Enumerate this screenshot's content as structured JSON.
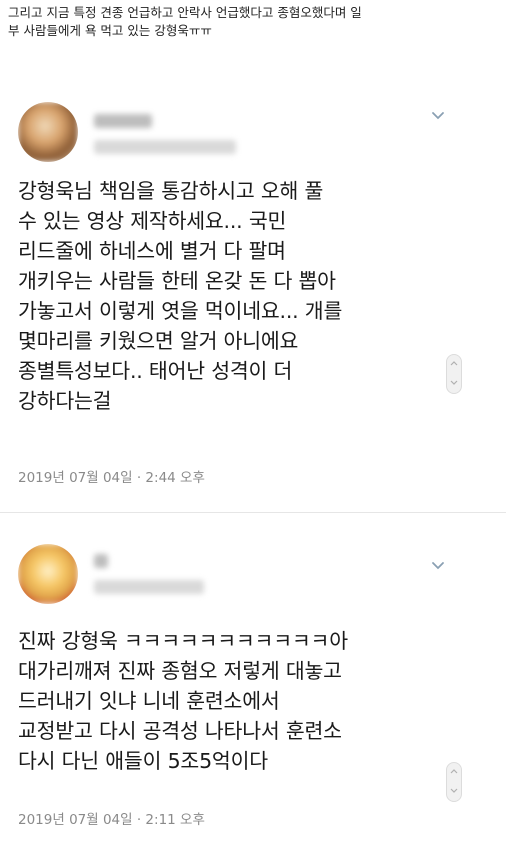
{
  "caption": {
    "line1": "그리고 지금 특정 견종 언급하고 안락사 언급했다고 종혐오했다며 일",
    "line2": "부 사람들에게 욕 먹고 있는 강형욱ㅠㅠ"
  },
  "posts": [
    {
      "lines": [
        "강형욱님 책임을 통감하시고 오해 풀",
        "수 있는 영상 제작하세요... 국민",
        "리드줄에 하네스에 별거 다 팔며",
        "개키우는 사람들 한테 온갖 돈 다 뽑아",
        "가놓고서 이렇게 엿을 먹이네요... 개를",
        "몇마리를 키웠으면 알거 아니에요",
        "종별특성보다.. 태어난 성격이 더",
        "강하다는걸"
      ],
      "timestamp": "2019년 07월 04일 · 2:44 오후"
    },
    {
      "lines": [
        "진짜 강형욱 ㅋㅋㅋㅋㅋㅋㅋㅋㅋㅋㅋ아",
        "대가리깨져 진짜 종혐오 저렇게 대놓고",
        "드러내기 잇냐 니네 훈련소에서",
        "교정받고 다시 공격성 나타나서 훈련소",
        "다시 다닌 애들이 5조5억이다"
      ],
      "timestamp": "2019년 07월 04일 · 2:11 오후"
    }
  ],
  "icons": {
    "menu": "chevron-down-icon",
    "scroll": "scroll-thumb-icon"
  }
}
